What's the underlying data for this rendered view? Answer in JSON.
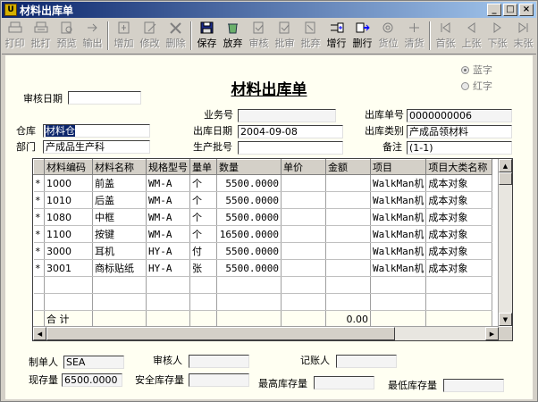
{
  "window": {
    "title": "材料出库单",
    "controls": [
      "_",
      "□",
      "×"
    ]
  },
  "toolbar": [
    {
      "label": "打印",
      "icon": "printer-icon",
      "enabled": false
    },
    {
      "label": "批打",
      "icon": "batch-print-icon",
      "enabled": false
    },
    {
      "label": "预览",
      "icon": "preview-icon",
      "enabled": false
    },
    {
      "label": "输出",
      "icon": "export-icon",
      "enabled": false
    },
    {
      "sep": true
    },
    {
      "label": "增加",
      "icon": "add-icon",
      "enabled": false
    },
    {
      "label": "修改",
      "icon": "edit-icon",
      "enabled": false
    },
    {
      "label": "删除",
      "icon": "delete-icon",
      "enabled": false
    },
    {
      "sep": true
    },
    {
      "label": "保存",
      "icon": "save-icon",
      "enabled": true
    },
    {
      "label": "放弃",
      "icon": "abandon-icon",
      "enabled": true
    },
    {
      "label": "审核",
      "icon": "audit-icon",
      "enabled": false
    },
    {
      "label": "批审",
      "icon": "batch-audit-icon",
      "enabled": false
    },
    {
      "label": "批弃",
      "icon": "batch-abandon-icon",
      "enabled": false
    },
    {
      "label": "增行",
      "icon": "add-row-icon",
      "enabled": true
    },
    {
      "label": "删行",
      "icon": "delete-row-icon",
      "enabled": true
    },
    {
      "label": "货位",
      "icon": "location-icon",
      "enabled": false
    },
    {
      "label": "清货",
      "icon": "clear-goods-icon",
      "enabled": false
    },
    {
      "sep": true
    },
    {
      "label": "首张",
      "icon": "first-icon",
      "enabled": false
    },
    {
      "label": "上张",
      "icon": "prev-icon",
      "enabled": false
    },
    {
      "label": "下张",
      "icon": "next-icon",
      "enabled": false
    },
    {
      "label": "末张",
      "icon": "last-icon",
      "enabled": false
    }
  ],
  "form": {
    "title": "材料出库单",
    "radio_blue": "蓝字",
    "radio_red": "红字",
    "audit_date_label": "审核日期",
    "audit_date": "",
    "business_no_label": "业务号",
    "business_no": "",
    "out_no_label": "出库单号",
    "out_no": "0000000006",
    "warehouse_label": "仓库",
    "warehouse": "材料仓",
    "out_date_label": "出库日期",
    "out_date": "2004-09-08",
    "out_type_label": "出库类别",
    "out_type": "产成品领材料",
    "dept_label": "部门",
    "dept": "产成品生产科",
    "batch_label": "生产批号",
    "batch": "",
    "remark_label": "备注",
    "remark": "(1-1)"
  },
  "grid": {
    "headers": [
      "材料编码",
      "材料名称",
      "规格型号",
      "量单",
      "数量",
      "单价",
      "金额",
      "项目",
      "项目大类名称"
    ],
    "rows": [
      {
        "mark": "*",
        "code": "1000",
        "name": "前盖",
        "spec": "WM-A",
        "unit": "个",
        "qty": "5500.0000",
        "price": "",
        "amount": "",
        "project": "WalkMan机",
        "category": "成本对象"
      },
      {
        "mark": "*",
        "code": "1010",
        "name": "后盖",
        "spec": "WM-A",
        "unit": "个",
        "qty": "5500.0000",
        "price": "",
        "amount": "",
        "project": "WalkMan机",
        "category": "成本对象"
      },
      {
        "mark": "*",
        "code": "1080",
        "name": "中框",
        "spec": "WM-A",
        "unit": "个",
        "qty": "5500.0000",
        "price": "",
        "amount": "",
        "project": "WalkMan机",
        "category": "成本对象"
      },
      {
        "mark": "*",
        "code": "1100",
        "name": "按键",
        "spec": "WM-A",
        "unit": "个",
        "qty": "16500.0000",
        "price": "",
        "amount": "",
        "project": "WalkMan机",
        "category": "成本对象"
      },
      {
        "mark": "*",
        "code": "3000",
        "name": "耳机",
        "spec": "HY-A",
        "unit": "付",
        "qty": "5500.0000",
        "price": "",
        "amount": "",
        "project": "WalkMan机",
        "category": "成本对象"
      },
      {
        "mark": "*",
        "code": "3001",
        "name": "商标贴纸",
        "spec": "HY-A",
        "unit": "张",
        "qty": "5500.0000",
        "price": "",
        "amount": "",
        "project": "WalkMan机",
        "category": "成本对象"
      }
    ],
    "sum_label": "合 计",
    "sum_amount": "0.00"
  },
  "footer": {
    "maker_label": "制单人",
    "maker": "SEA",
    "auditor_label": "审核人",
    "auditor": "",
    "bookkeeper_label": "记账人",
    "bookkeeper": "",
    "stock_label": "现存量",
    "stock": "6500.0000",
    "safety_label": "安全库存量",
    "safety": "",
    "max_label": "最高库存量",
    "max": "",
    "min_label": "最低库存量",
    "min": ""
  }
}
